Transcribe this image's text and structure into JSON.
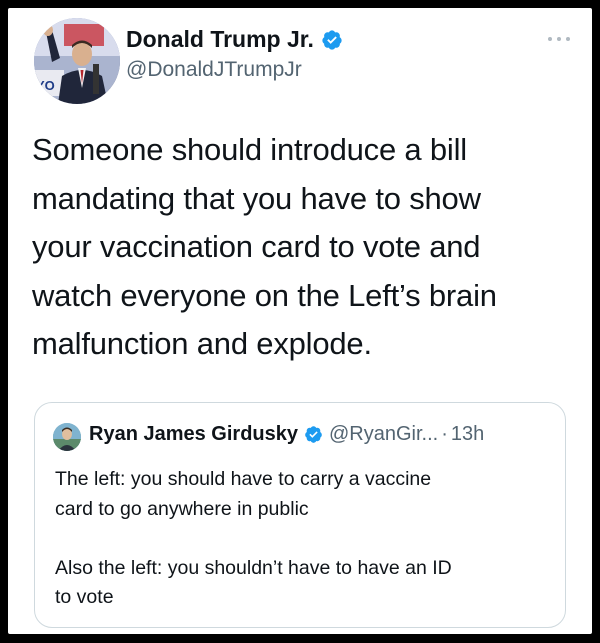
{
  "tweet": {
    "author_name": "Donald Trump Jr.",
    "author_handle": "@DonaldJTrumpJr",
    "verified": true,
    "text_lines": [
      "Someone should introduce a bill",
      "mandating that you have to show",
      "your vaccination card to vote and",
      "watch everyone on the Left’s brain",
      "malfunction and explode."
    ],
    "avatar_sign_text": "YO",
    "more_icon": "more-horizontal-icon"
  },
  "quoted_tweet": {
    "author_name": "Ryan James Girdusky",
    "author_handle": "@RyanGir...",
    "separator": "·",
    "time": "13h",
    "verified": true,
    "paragraph1_lines": [
      "The left: you should have to carry a vaccine",
      "card to go anywhere in public"
    ],
    "paragraph2_lines": [
      "Also the left: you shouldn’t have to have an ID",
      "to vote"
    ]
  },
  "colors": {
    "verified_blue": "#1d9bf0",
    "text_primary": "#0f1419",
    "text_secondary": "#536471",
    "border": "#cfd9de"
  }
}
